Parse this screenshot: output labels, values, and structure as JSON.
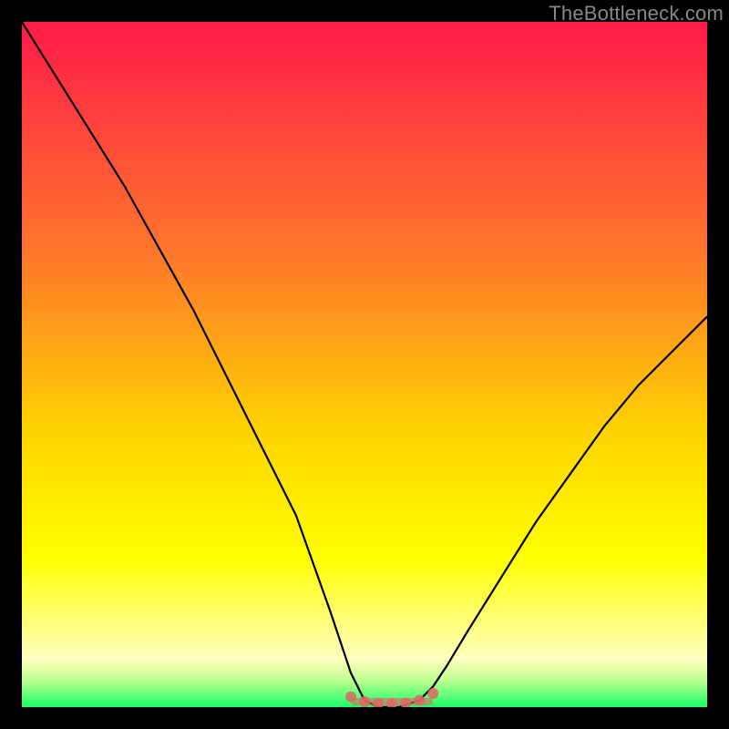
{
  "attribution": "TheBottleneck.com",
  "colors": {
    "gradient_top": "#ff1a4a",
    "gradient_mid1": "#ff7a2a",
    "gradient_mid2": "#ffd400",
    "gradient_mid3": "#ffff80",
    "gradient_bottom": "#1aff66",
    "curve": "#000000",
    "marker": "#e06666",
    "frame": "#000000"
  },
  "chart_data": {
    "type": "line",
    "title": "",
    "xlabel": "",
    "ylabel": "",
    "xlim": [
      0,
      100
    ],
    "ylim": [
      0,
      100
    ],
    "series": [
      {
        "name": "bottleneck-curve",
        "x": [
          0,
          5,
          10,
          15,
          20,
          25,
          30,
          35,
          40,
          45,
          48,
          50,
          52,
          55,
          58,
          60,
          62,
          65,
          70,
          75,
          80,
          85,
          90,
          95,
          100
        ],
        "values": [
          100,
          92,
          84,
          76,
          67,
          58,
          48,
          38,
          28,
          14,
          5,
          1,
          0,
          0,
          1,
          3,
          6,
          11,
          19,
          27,
          34,
          41,
          47,
          52,
          57
        ]
      },
      {
        "name": "sweet-spot-markers",
        "x": [
          48,
          50,
          52,
          54,
          56,
          58,
          60
        ],
        "values": [
          1.5,
          0.8,
          0.5,
          0.5,
          0.6,
          1.0,
          2.0
        ]
      }
    ],
    "gradient_stops": [
      {
        "offset": 0.0,
        "color": "#ff1a4a"
      },
      {
        "offset": 0.35,
        "color": "#ff7a2a"
      },
      {
        "offset": 0.6,
        "color": "#ffd400"
      },
      {
        "offset": 0.78,
        "color": "#ffff00"
      },
      {
        "offset": 0.88,
        "color": "#ffff80"
      },
      {
        "offset": 0.93,
        "color": "#ffffc0"
      },
      {
        "offset": 0.96,
        "color": "#c0ff90"
      },
      {
        "offset": 1.0,
        "color": "#1aff66"
      }
    ]
  }
}
